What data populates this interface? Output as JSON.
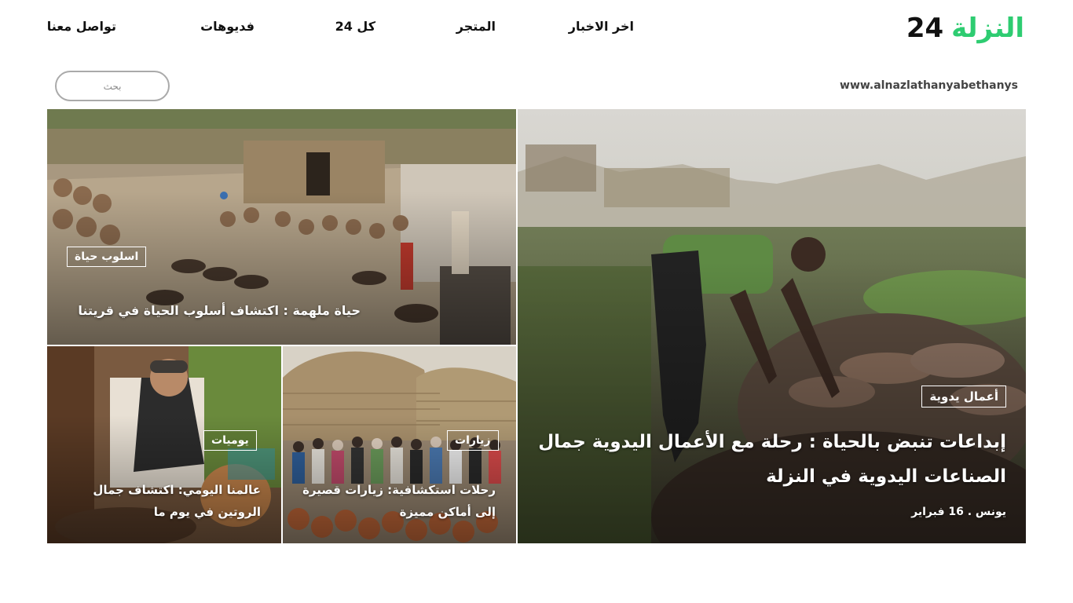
{
  "header": {
    "logo_word": "النزلة",
    "logo_number": "24",
    "nav": [
      {
        "label": "اخر الاخبار"
      },
      {
        "label": "المتجر"
      },
      {
        "label": "كل 24"
      },
      {
        "label": "فديوهات"
      },
      {
        "label": "تواصل معنا"
      }
    ]
  },
  "site_url": "www.alnazlathanyabethanys",
  "search": {
    "placeholder": "بحث"
  },
  "articles": {
    "main": {
      "tag": "أعمال يدوية",
      "title_line1": "إبداعات تنبض بالحياة : رحلة مع الأعمال اليدوية جمال",
      "title_line2": "الصناعات اليدوية في النزلة",
      "meta": "يونس . 16 فبراير"
    },
    "life": {
      "tag": "اسلوب حياة",
      "title": "حياة ملهمة : اكتشاف أسلوب الحياة في قريتنا"
    },
    "daily": {
      "tag": "يوميات",
      "title_line1": "عالمنا اليومي: اكتشاف جمال",
      "title_line2": "الروتين في يوم ما"
    },
    "trips": {
      "tag": "زيارات",
      "title_line1": "رحلات استكشافية: زيارات قصيرة",
      "title_line2": "إلى أماكن مميزة"
    }
  },
  "colors": {
    "brand_green": "#2ecc71",
    "text_dark": "#111111"
  }
}
